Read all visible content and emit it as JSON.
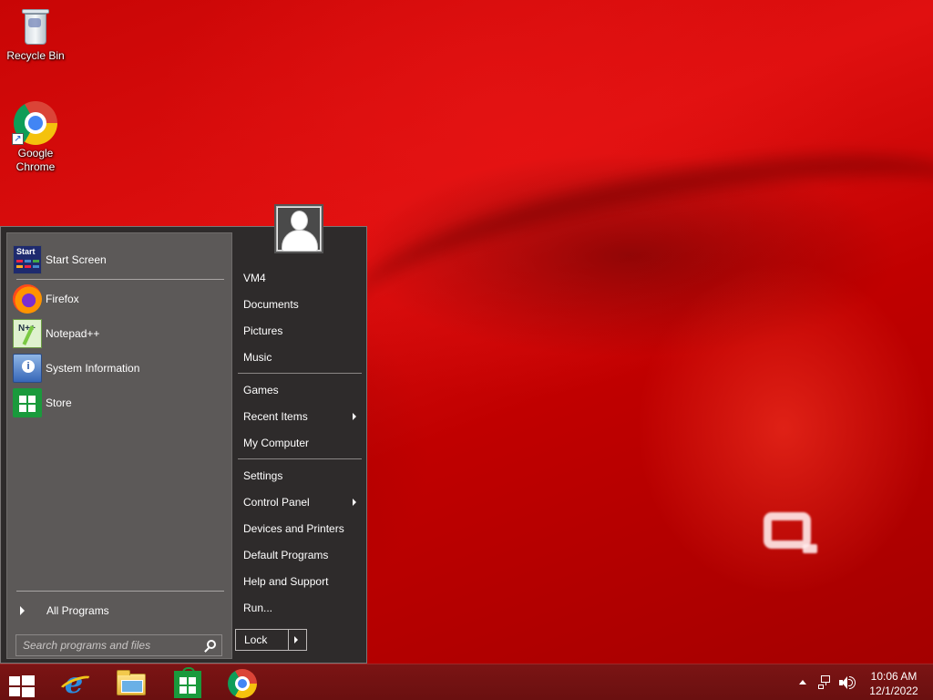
{
  "desktop": {
    "icons": [
      {
        "label": "Recycle Bin",
        "icon": "recycle-bin-icon"
      },
      {
        "label": "Google\nChrome",
        "icon": "chrome-icon"
      }
    ]
  },
  "start_menu": {
    "pinned": [
      {
        "label": "Start Screen",
        "icon": "start-screen-icon"
      }
    ],
    "recent": [
      {
        "label": "Firefox",
        "icon": "firefox-icon"
      },
      {
        "label": "Notepad++",
        "icon": "notepad-plus-plus-icon"
      },
      {
        "label": "System Information",
        "icon": "system-information-icon"
      },
      {
        "label": "Store",
        "icon": "store-icon"
      }
    ],
    "all_programs": "All Programs",
    "search_placeholder": "Search programs and files",
    "right": {
      "group1": [
        "VM4",
        "Documents",
        "Pictures",
        "Music"
      ],
      "group2": [
        {
          "label": "Games",
          "submenu": false
        },
        {
          "label": "Recent Items",
          "submenu": true
        },
        {
          "label": "My Computer",
          "submenu": false
        }
      ],
      "group3": [
        {
          "label": "Settings",
          "submenu": false
        },
        {
          "label": "Control Panel",
          "submenu": true
        },
        {
          "label": "Devices and Printers",
          "submenu": false
        },
        {
          "label": "Default Programs",
          "submenu": false
        },
        {
          "label": "Help and Support",
          "submenu": false
        },
        {
          "label": "Run...",
          "submenu": false
        }
      ]
    },
    "lock_label": "Lock",
    "start_screen_tile_text": "Start"
  },
  "taskbar": {
    "apps": [
      "windows-start-icon",
      "internet-explorer-icon",
      "file-explorer-icon",
      "store-icon",
      "chrome-icon"
    ],
    "clock": {
      "time": "10:06 AM",
      "date": "12/1/2022"
    }
  },
  "colors": {
    "wallpaper": "#c80505",
    "start_menu_bg": "#2e2b2b",
    "left_pane_bg": "#5c5958",
    "taskbar_bg": "#6f1111"
  }
}
